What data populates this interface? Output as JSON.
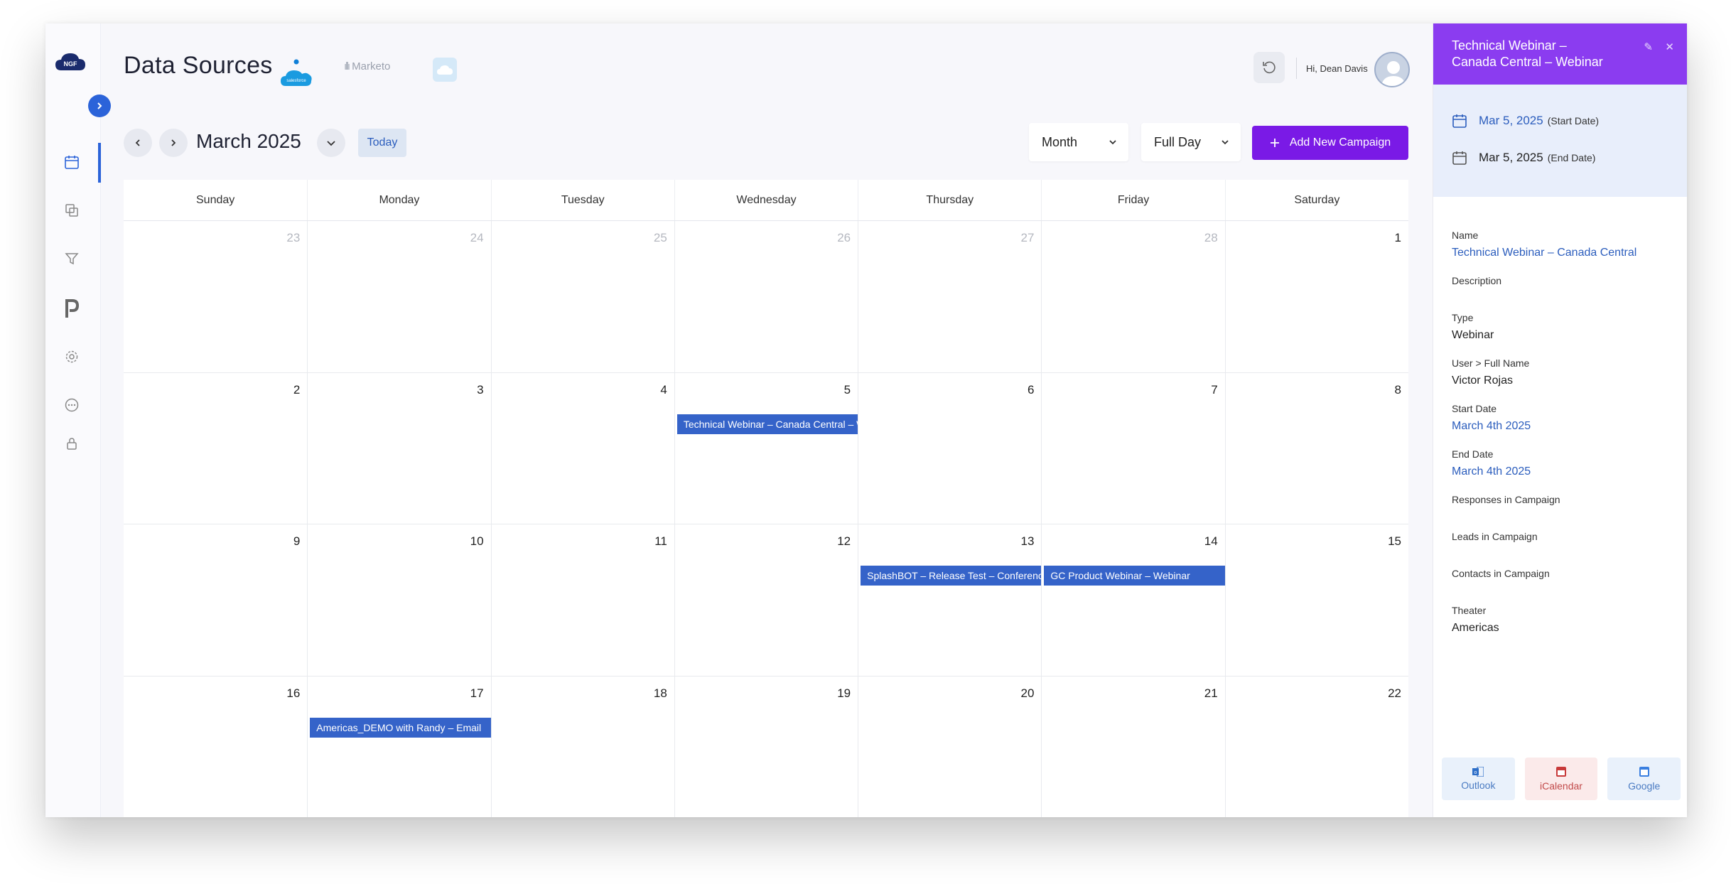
{
  "app": {
    "logo_text": "NGF"
  },
  "header": {
    "title": "Data Sources",
    "sources": [
      "salesforce",
      "Marketo"
    ],
    "greeting": "Hi, Dean Davis"
  },
  "toolbar": {
    "month_label": "March 2025",
    "today_label": "Today",
    "view_select": "Month",
    "time_select": "Full Day",
    "add_label": "Add New Campaign"
  },
  "calendar": {
    "weekdays": [
      "Sunday",
      "Monday",
      "Tuesday",
      "Wednesday",
      "Thursday",
      "Friday",
      "Saturday"
    ],
    "weeks": [
      [
        {
          "d": "23",
          "m": true
        },
        {
          "d": "24",
          "m": true
        },
        {
          "d": "25",
          "m": true
        },
        {
          "d": "26",
          "m": true
        },
        {
          "d": "27",
          "m": true
        },
        {
          "d": "28",
          "m": true
        },
        {
          "d": "1"
        }
      ],
      [
        {
          "d": "2"
        },
        {
          "d": "3"
        },
        {
          "d": "4"
        },
        {
          "d": "5",
          "e": "Technical Webinar – Canada Central – Webinar"
        },
        {
          "d": "6"
        },
        {
          "d": "7"
        },
        {
          "d": "8"
        }
      ],
      [
        {
          "d": "9"
        },
        {
          "d": "10"
        },
        {
          "d": "11"
        },
        {
          "d": "12"
        },
        {
          "d": "13",
          "e": "SplashBOT – Release Test – Conference"
        },
        {
          "d": "14",
          "e": "GC Product Webinar – Webinar"
        },
        {
          "d": "15"
        }
      ],
      [
        {
          "d": "16"
        },
        {
          "d": "17",
          "e": "Americas_DEMO with Randy – Email"
        },
        {
          "d": "18"
        },
        {
          "d": "19"
        },
        {
          "d": "20"
        },
        {
          "d": "21"
        },
        {
          "d": "22"
        }
      ]
    ]
  },
  "panel": {
    "title_line1": "Technical Webinar –",
    "title_line2": "Canada Central – Webinar",
    "start_date": "Mar 5, 2025",
    "start_suffix": "(Start Date)",
    "end_date": "Mar 5, 2025",
    "end_suffix": "(End Date)",
    "fields": [
      {
        "label": "Name",
        "value": "Technical Webinar – Canada Central",
        "link": true
      },
      {
        "label": "Description",
        "value": ""
      },
      {
        "label": "Type",
        "value": "Webinar"
      },
      {
        "label": "User > Full Name",
        "value": "Victor Rojas"
      },
      {
        "label": "Start Date",
        "value": "March 4th 2025",
        "link": true
      },
      {
        "label": "End Date",
        "value": "March 4th 2025",
        "link": true
      },
      {
        "label": "Responses in Campaign",
        "value": ""
      },
      {
        "label": "Leads in Campaign",
        "value": ""
      },
      {
        "label": "Contacts in Campaign",
        "value": ""
      },
      {
        "label": "Theater",
        "value": "Americas"
      }
    ],
    "exports": {
      "outlook": "Outlook",
      "ical": "iCalendar",
      "google": "Google"
    }
  },
  "colors": {
    "accent": "#7a1ae6",
    "panel_header": "#8b3cf0",
    "event": "#3563c9",
    "link": "#2b5dbd"
  }
}
